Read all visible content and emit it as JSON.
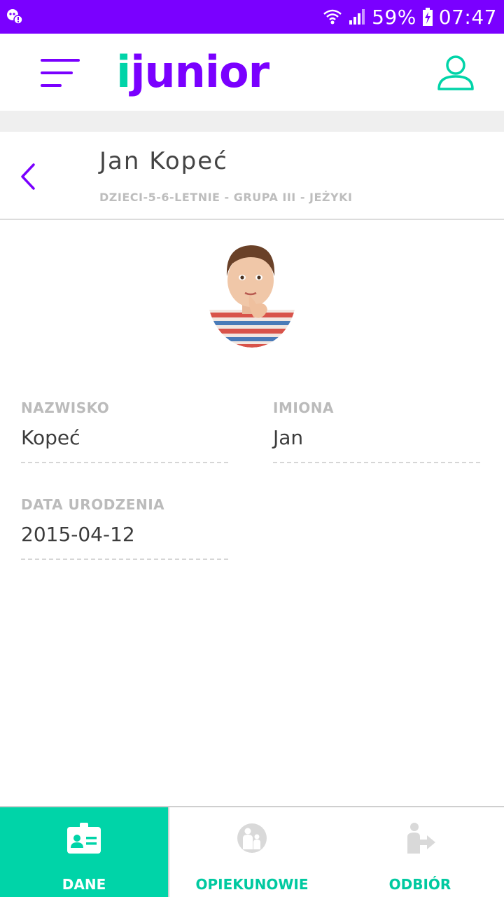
{
  "status_bar": {
    "battery_percent": "59%",
    "time": "07:47",
    "icons": [
      "notification-icon",
      "wifi-icon",
      "signal-icon",
      "battery-charging-icon"
    ]
  },
  "header": {
    "logo_text": "junior",
    "logo_i": "i",
    "menu_icon": "hamburger-menu-icon",
    "profile_icon": "user-profile-icon"
  },
  "child": {
    "name": "Jan Kopeć",
    "group": "DZIECI-5-6-LETNIE - GRUPA III - JEŻYKI"
  },
  "fields": {
    "surname": {
      "label": "NAZWISKO",
      "value": "Kopeć"
    },
    "first_names": {
      "label": "IMIONA",
      "value": "Jan"
    },
    "birth_date": {
      "label": "DATA URODZENIA",
      "value": "2015-04-12"
    }
  },
  "bottom_nav": {
    "tabs": [
      {
        "label": "DANE",
        "icon": "id-card-icon",
        "active": true
      },
      {
        "label": "OPIEKUNOWIE",
        "icon": "guardians-icon",
        "active": false
      },
      {
        "label": "ODBIÓR",
        "icon": "pickup-icon",
        "active": false
      }
    ]
  },
  "colors": {
    "brand_purple": "#7a00ff",
    "brand_teal": "#00d4a8",
    "label_grey": "#bbbbbb"
  }
}
